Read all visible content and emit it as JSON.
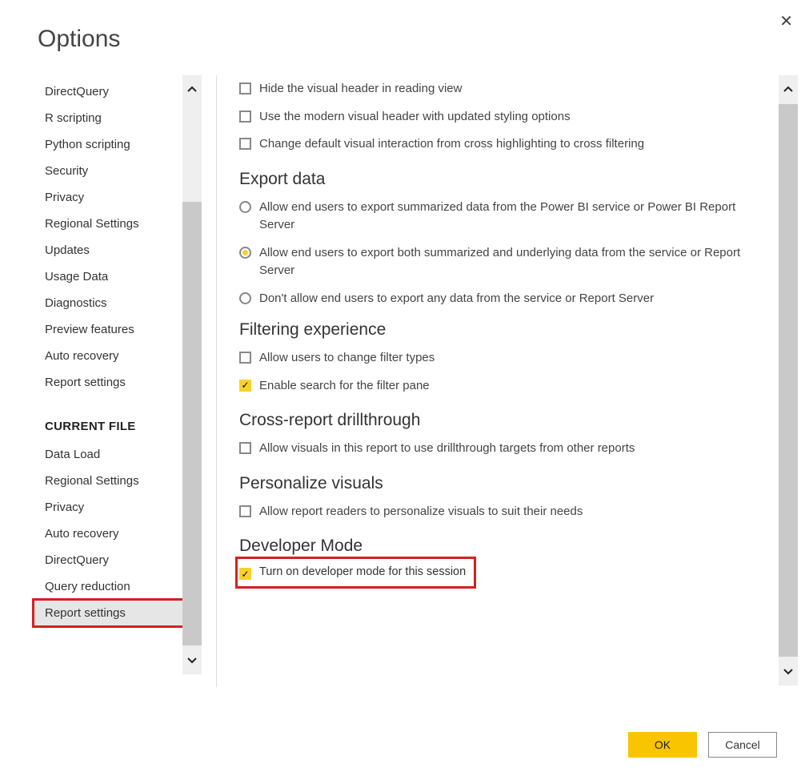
{
  "window": {
    "title": "Options"
  },
  "sidebar": {
    "global_items": [
      "DirectQuery",
      "R scripting",
      "Python scripting",
      "Security",
      "Privacy",
      "Regional Settings",
      "Updates",
      "Usage Data",
      "Diagnostics",
      "Preview features",
      "Auto recovery",
      "Report settings"
    ],
    "current_file_heading": "CURRENT FILE",
    "current_file_items": [
      "Data Load",
      "Regional Settings",
      "Privacy",
      "Auto recovery",
      "DirectQuery",
      "Query reduction",
      "Report settings"
    ],
    "selected_index": 6,
    "highlighted_index": 6
  },
  "main": {
    "visual_header": {
      "items": [
        {
          "label": "Hide the visual header in reading view",
          "checked": false
        },
        {
          "label": "Use the modern visual header with updated styling options",
          "checked": false
        },
        {
          "label": "Change default visual interaction from cross highlighting to cross filtering",
          "checked": false
        }
      ]
    },
    "export_data": {
      "heading": "Export data",
      "options": [
        "Allow end users to export summarized data from the Power BI service or Power BI Report Server",
        "Allow end users to export both summarized and underlying data from the service or Report Server",
        "Don't allow end users to export any data from the service or Report Server"
      ],
      "selected": 1
    },
    "filtering": {
      "heading": "Filtering experience",
      "items": [
        {
          "label": "Allow users to change filter types",
          "checked": false
        },
        {
          "label": "Enable search for the filter pane",
          "checked": true
        }
      ]
    },
    "cross_report": {
      "heading": "Cross-report drillthrough",
      "item": {
        "label": "Allow visuals in this report to use drillthrough targets from other reports",
        "checked": false
      }
    },
    "personalize": {
      "heading": "Personalize visuals",
      "item": {
        "label": "Allow report readers to personalize visuals to suit their needs",
        "checked": false
      }
    },
    "developer": {
      "heading": "Developer Mode",
      "item": {
        "label": "Turn on developer mode for this session",
        "checked": true
      }
    }
  },
  "footer": {
    "ok": "OK",
    "cancel": "Cancel"
  }
}
